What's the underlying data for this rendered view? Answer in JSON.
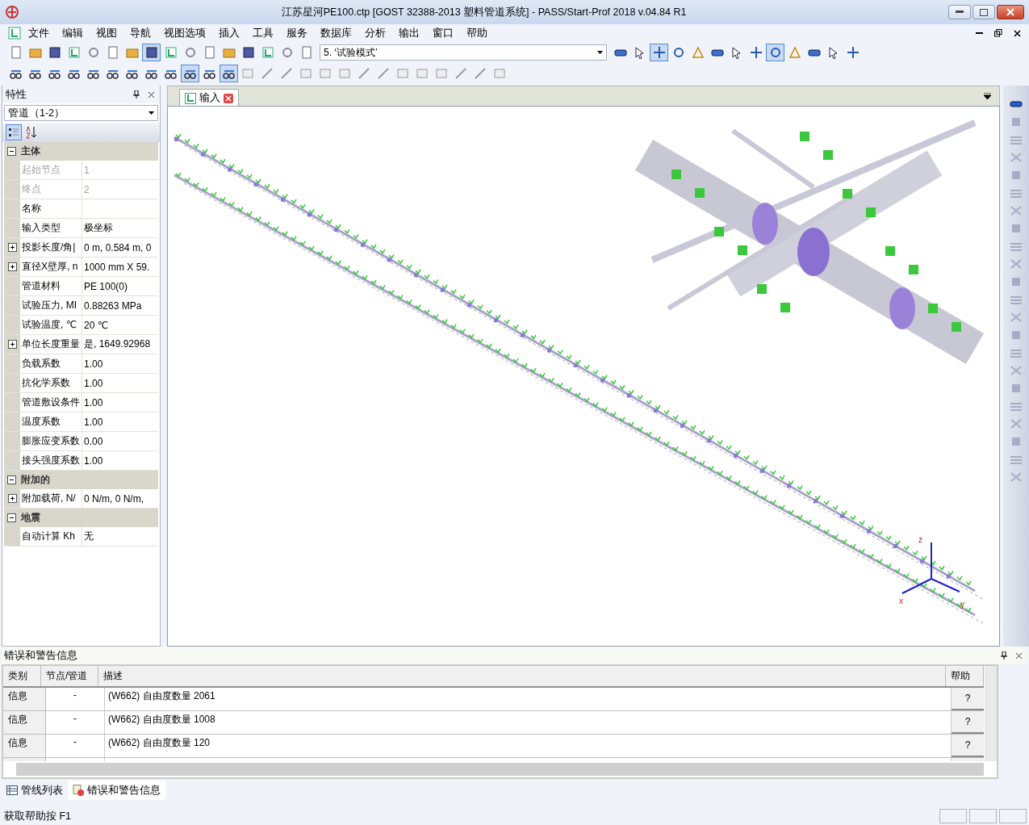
{
  "window": {
    "title": "江苏星河PE100.ctp [GOST 32388-2013 塑料管道系统] - PASS/Start-Prof 2018 v.04.84 R1"
  },
  "menu": [
    "文件",
    "编辑",
    "视图",
    "导航",
    "视图选项",
    "插入",
    "工具",
    "服务",
    "数据库",
    "分析",
    "输出",
    "窗口",
    "帮助"
  ],
  "toolbar_1": [
    {
      "selected": false
    },
    {
      "selected": false
    },
    {
      "selected": false
    },
    {
      "selected": false
    },
    {
      "selected": false
    },
    {
      "selected": false
    },
    {
      "selected": false
    },
    {
      "selected": true
    },
    {
      "selected": false
    },
    {
      "selected": false
    },
    {
      "selected": false
    },
    {
      "selected": false
    },
    {
      "selected": false
    },
    {
      "selected": false
    },
    {
      "selected": false
    },
    {
      "selected": false
    }
  ],
  "mode_combo": {
    "value": "5. ‘试验模式’"
  },
  "toolbar_1b": [
    {
      "selected": false
    },
    {
      "selected": false
    },
    {
      "selected": true
    },
    {
      "selected": false
    },
    {
      "selected": false
    },
    {
      "selected": false
    },
    {
      "selected": false
    },
    {
      "selected": false
    },
    {
      "selected": true
    },
    {
      "selected": false
    },
    {
      "selected": false
    },
    {
      "selected": false
    },
    {
      "selected": false
    }
  ],
  "toolbar_2": [
    {
      "selected": false
    },
    {
      "selected": false
    },
    {
      "selected": false
    },
    {
      "selected": false
    },
    {
      "selected": false
    },
    {
      "selected": false
    },
    {
      "selected": false
    },
    {
      "selected": false
    },
    {
      "selected": false
    },
    {
      "selected": true
    },
    {
      "selected": false
    },
    {
      "selected": true
    },
    {
      "selected": false
    },
    {
      "selected": false
    },
    {
      "selected": false
    },
    {
      "selected": false
    },
    {
      "selected": false
    },
    {
      "selected": false
    },
    {
      "selected": false
    },
    {
      "selected": false
    },
    {
      "selected": false
    },
    {
      "selected": false
    },
    {
      "selected": false
    },
    {
      "selected": false
    },
    {
      "selected": false
    },
    {
      "selected": false
    }
  ],
  "properties": {
    "title": "特性",
    "object": "管道（1-2）",
    "sections": [
      {
        "title": "主体",
        "expanded": true,
        "rows": [
          {
            "name": "起始节点",
            "value": "1",
            "disabled": true,
            "expandable": false
          },
          {
            "name": "终点",
            "value": "2",
            "disabled": true,
            "expandable": false
          },
          {
            "name": "名称",
            "value": "",
            "disabled": false,
            "expandable": false
          },
          {
            "name": "输入类型",
            "value": "极坐标",
            "disabled": false,
            "expandable": false
          },
          {
            "name": "投影长度/角|",
            "value": "0 m, 0.584 m, 0",
            "disabled": false,
            "expandable": true
          },
          {
            "name": "直径X壁厚, n",
            "value": "1000 mm X 59.",
            "disabled": false,
            "expandable": true
          },
          {
            "name": "管道材料",
            "value": "PE 100(0)",
            "disabled": false,
            "expandable": false
          },
          {
            "name": "试验压力, MI",
            "value": "0.88263 MPa",
            "disabled": false,
            "expandable": false
          },
          {
            "name": "试验温度, ℃",
            "value": "20 ℃",
            "disabled": false,
            "expandable": false
          },
          {
            "name": "单位长度重量",
            "value": "是, 1649.92968",
            "disabled": false,
            "expandable": true
          },
          {
            "name": "负载系数",
            "value": "1.00",
            "disabled": false,
            "expandable": false
          },
          {
            "name": "抗化学系数",
            "value": "1.00",
            "disabled": false,
            "expandable": false
          },
          {
            "name": "管道敷设条件",
            "value": "1.00",
            "disabled": false,
            "expandable": false
          },
          {
            "name": "温度系数",
            "value": "1.00",
            "disabled": false,
            "expandable": false
          },
          {
            "name": "膨胀应变系数",
            "value": "0.00",
            "disabled": false,
            "expandable": false
          },
          {
            "name": "接头强度系数",
            "value": "1.00",
            "disabled": false,
            "expandable": false
          }
        ]
      },
      {
        "title": "附加的",
        "expanded": true,
        "rows": [
          {
            "name": "附加载荷, N/",
            "value": "0 N/m, 0 N/m,",
            "disabled": false,
            "expandable": true
          }
        ]
      },
      {
        "title": "地震",
        "expanded": true,
        "rows": [
          {
            "name": "自动计算 Kh",
            "value": "无",
            "disabled": false,
            "expandable": false
          }
        ]
      }
    ]
  },
  "document_tabs": [
    {
      "label": "输入",
      "selected": true
    }
  ],
  "view": {
    "axis_labels": [
      "z",
      "x",
      "y"
    ]
  },
  "messages": {
    "title": "错误和警告信息",
    "columns": [
      "类别",
      "节点/管道",
      "描述",
      "帮助"
    ],
    "rows": [
      {
        "category": "信息",
        "node": "-",
        "description": "(W662) 自由度数量 2061",
        "help": "?"
      },
      {
        "category": "信息",
        "node": "-",
        "description": "(W662) 自由度数量 1008",
        "help": "?"
      },
      {
        "category": "信息",
        "node": "-",
        "description": "(W662) 自由度数量 120",
        "help": "?"
      }
    ]
  },
  "bottom_tabs": [
    {
      "label": "管线列表",
      "selected": false
    },
    {
      "label": "错误和警告信息",
      "selected": true
    }
  ],
  "status_bar": {
    "text": "获取帮助按 F1"
  }
}
